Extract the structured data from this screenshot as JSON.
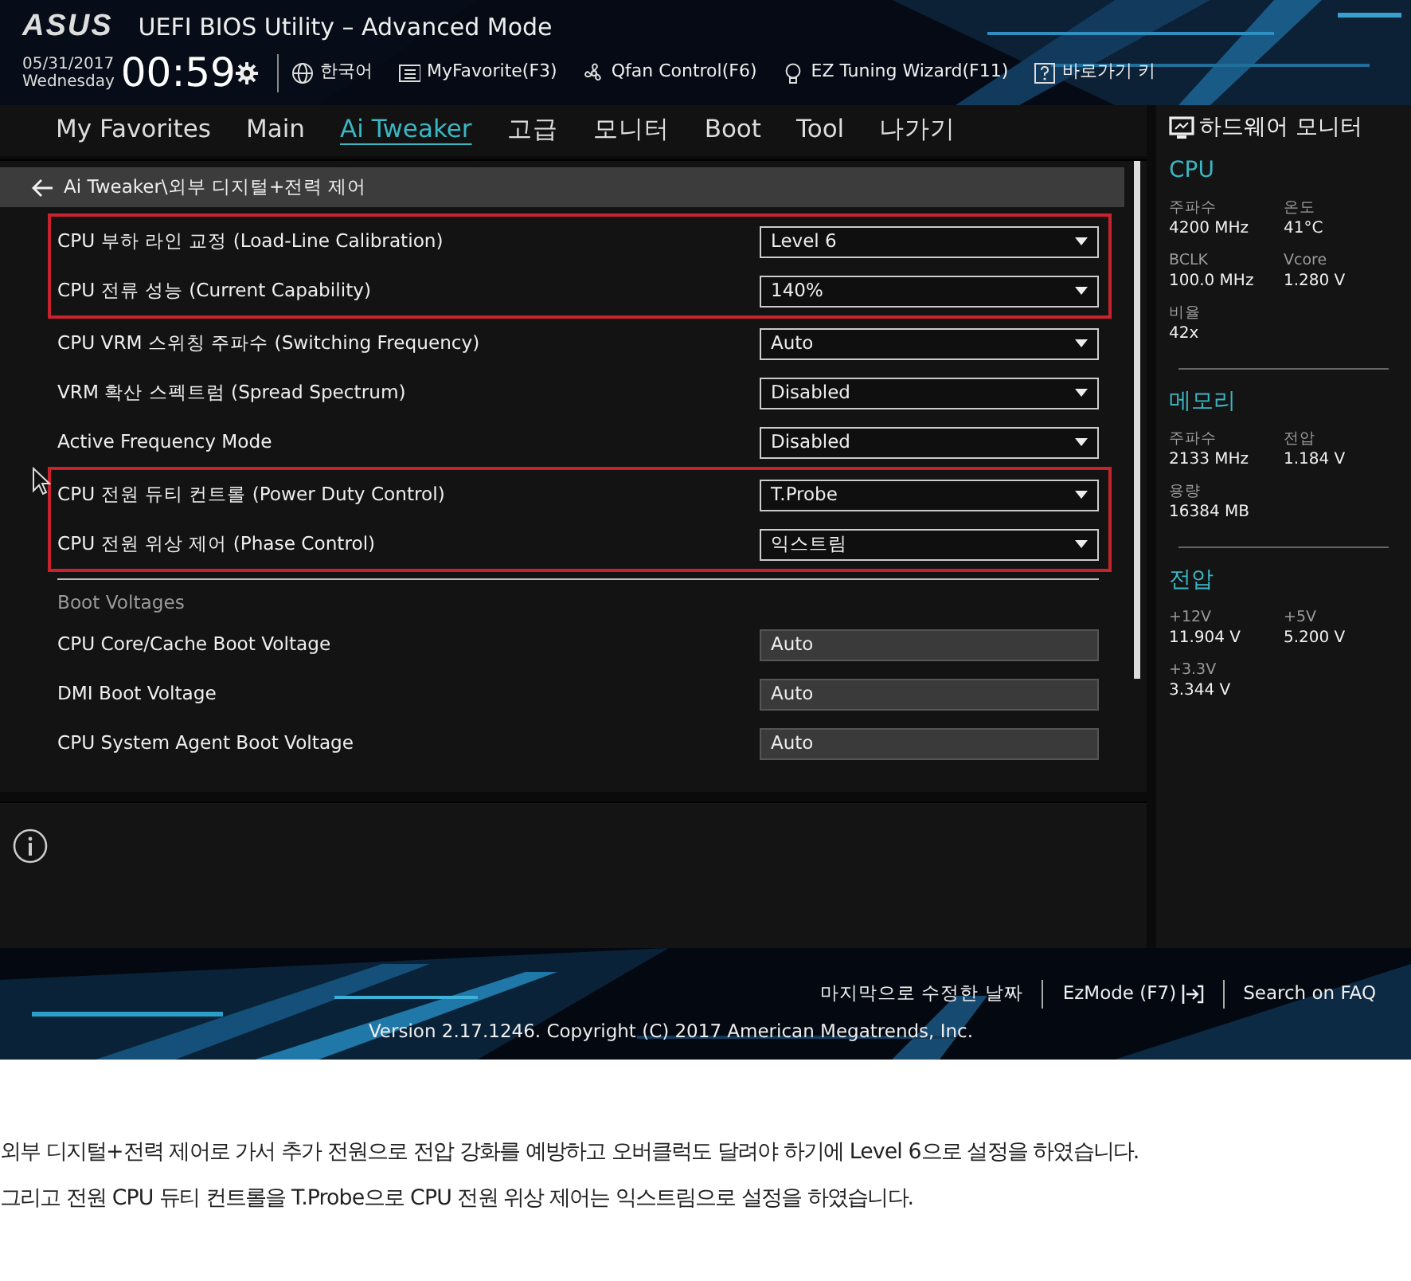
{
  "header": {
    "logo": "ASUS",
    "title": "UEFI BIOS Utility – Advanced Mode",
    "date": "05/31/2017",
    "weekday": "Wednesday",
    "time": "00:59",
    "tools": [
      {
        "kind": "language",
        "label": "한국어"
      },
      {
        "kind": "favorite",
        "label": "MyFavorite(F3)"
      },
      {
        "kind": "fan",
        "label": "Qfan Control(F6)"
      },
      {
        "kind": "bulb",
        "label": "EZ Tuning Wizard(F11)"
      },
      {
        "kind": "help",
        "label": "바로가기 키"
      }
    ]
  },
  "tabs": [
    {
      "label": "My Favorites",
      "selected": false
    },
    {
      "label": "Main",
      "selected": false
    },
    {
      "label": "Ai Tweaker",
      "selected": true
    },
    {
      "label": "고급",
      "selected": false
    },
    {
      "label": "모니터",
      "selected": false
    },
    {
      "label": "Boot",
      "selected": false
    },
    {
      "label": "Tool",
      "selected": false
    },
    {
      "label": "나가기",
      "selected": false
    }
  ],
  "breadcrumb": "Ai Tweaker\\외부 디지털+전력 제어",
  "settings": [
    {
      "kind": "dropdown",
      "label": "CPU 부하 라인 교정 (Load-Line Calibration)",
      "value": "Level 6",
      "highlighted": true
    },
    {
      "kind": "dropdown",
      "label": "CPU 전류 성능 (Current Capability)",
      "value": "140%",
      "highlighted": true
    },
    {
      "kind": "dropdown",
      "label": "CPU VRM 스위칭 주파수 (Switching Frequency)",
      "value": "Auto",
      "highlighted": false
    },
    {
      "kind": "dropdown",
      "label": "VRM 확산 스펙트럼 (Spread Spectrum)",
      "value": "Disabled",
      "highlighted": false
    },
    {
      "kind": "dropdown",
      "label": "Active Frequency Mode",
      "value": "Disabled",
      "highlighted": false
    },
    {
      "kind": "dropdown",
      "label": "CPU 전원 듀티 컨트롤 (Power Duty Control)",
      "value": "T.Probe",
      "highlighted": true
    },
    {
      "kind": "dropdown",
      "label": "CPU 전원 위상 제어 (Phase Control)",
      "value": "익스트림",
      "highlighted": true
    },
    {
      "kind": "heading",
      "label": "Boot Voltages"
    },
    {
      "kind": "field",
      "label": "CPU Core/Cache Boot Voltage",
      "value": "Auto"
    },
    {
      "kind": "field",
      "label": "DMI Boot Voltage",
      "value": "Auto"
    },
    {
      "kind": "field",
      "label": "CPU System Agent Boot Voltage",
      "value": "Auto"
    }
  ],
  "monitor": {
    "title": "하드웨어 모니터",
    "sections": [
      {
        "title": "CPU",
        "items": [
          {
            "label": "주파수",
            "value": "4200 MHz"
          },
          {
            "label": "온도",
            "value": "41°C"
          },
          {
            "label": "BCLK",
            "value": "100.0 MHz"
          },
          {
            "label": "Vcore",
            "value": "1.280 V"
          },
          {
            "label": "비율",
            "value": "42x"
          }
        ]
      },
      {
        "title": "메모리",
        "items": [
          {
            "label": "주파수",
            "value": "2133 MHz"
          },
          {
            "label": "전압",
            "value": "1.184 V"
          },
          {
            "label": "용량",
            "value": "16384 MB"
          }
        ]
      },
      {
        "title": "전압",
        "items": [
          {
            "label": "+12V",
            "value": "11.904 V"
          },
          {
            "label": "+5V",
            "value": "5.200 V"
          },
          {
            "label": "+3.3V",
            "value": "3.344 V"
          }
        ]
      }
    ]
  },
  "footer": {
    "links": [
      {
        "kind": "text",
        "label": "마지막으로 수정한 날짜"
      },
      {
        "kind": "exit",
        "label": "EzMode (F7)"
      },
      {
        "kind": "text",
        "label": "Search on FAQ"
      }
    ],
    "version": "Version 2.17.1246. Copyright (C) 2017 American Megatrends, Inc."
  },
  "caption": [
    "외부 디지털+전력 제어로 가서 추가 전원으로 전압 강화를 예방하고 오버클럭도 달려야 하기에 Level 6으로 설정을 하였습니다.",
    "그리고 전원 CPU 듀티 컨트롤을 T.Probe으로 CPU 전원 위상 제어는 익스트림으로 설정을 하였습니다."
  ]
}
